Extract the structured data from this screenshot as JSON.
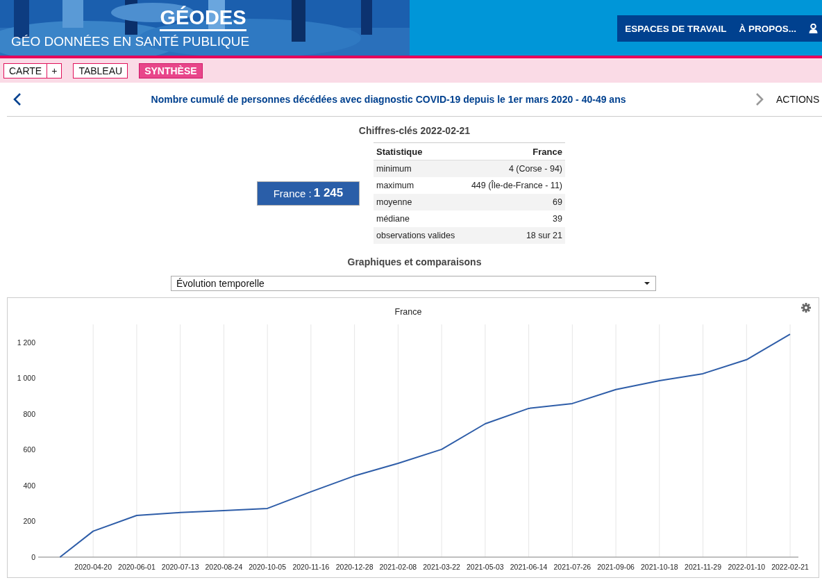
{
  "header": {
    "title": "GÉODES",
    "subtitle": "GÉO DONNÉES EN SANTÉ PUBLIQUE",
    "nav": [
      "ESPACES DE TRAVAIL",
      "À PROPOS..."
    ]
  },
  "tabs": [
    {
      "label": "CARTE",
      "selected": false,
      "extra": "+"
    },
    {
      "label": "TABLEAU",
      "selected": false
    },
    {
      "label": "SYNTHÈSE",
      "selected": true
    }
  ],
  "indicator": {
    "title": "Nombre cumulé de personnes décédées avec diagnostic COVID-19 depuis le 1er mars 2020 - 40-49 ans",
    "actions": "ACTIONS"
  },
  "key_figures": {
    "heading": "Chiffres-clés 2022-02-21",
    "total_label": "France : ",
    "total_value": "1 245",
    "columns": [
      "Statistique",
      "France"
    ],
    "rows": [
      [
        "minimum",
        "4 (Corse - 94)"
      ],
      [
        "maximum",
        "449 (Île-de-France - 11)"
      ],
      [
        "moyenne",
        "69"
      ],
      [
        "médiane",
        "39"
      ],
      [
        "observations valides",
        "18 sur 21"
      ]
    ]
  },
  "charts": {
    "heading": "Graphiques et comparaisons",
    "dropdown": "Évolution temporelle",
    "chart_data": {
      "type": "line",
      "title": "France",
      "x": [
        "2020-03-19",
        "2020-04-20",
        "2020-06-01",
        "2020-07-13",
        "2020-08-24",
        "2020-10-05",
        "2020-11-16",
        "2020-12-28",
        "2021-02-08",
        "2021-03-22",
        "2021-05-03",
        "2021-06-14",
        "2021-07-26",
        "2021-09-06",
        "2021-10-18",
        "2021-11-29",
        "2022-01-10",
        "2022-02-21"
      ],
      "series": [
        {
          "color": "#2e5da8",
          "values": [
            0,
            145,
            233,
            249,
            260,
            272,
            365,
            454,
            524,
            602,
            745,
            831,
            858,
            936,
            986,
            1025,
            1103,
            1245
          ]
        }
      ],
      "ylim": [
        0,
        1300
      ],
      "xlim": [
        "2020-02-27",
        "2022-03-01"
      ],
      "grid": true,
      "yticks": [
        0,
        200,
        400,
        600,
        800,
        {
          "value": 1000,
          "label": "1 000"
        },
        {
          "value": 1200,
          "label": "1 200"
        }
      ],
      "xticks": [
        "2020-04-20",
        "2020-06-01",
        "2020-07-13",
        "2020-08-24",
        "2020-10-05",
        "2020-11-16",
        "2020-12-28",
        "2021-02-08",
        "2021-03-22",
        "2021-05-03",
        "2021-06-14",
        "2021-07-26",
        "2021-09-06",
        "2021-10-18",
        "2021-11-29",
        "2022-01-10",
        "2022-02-21"
      ]
    }
  }
}
